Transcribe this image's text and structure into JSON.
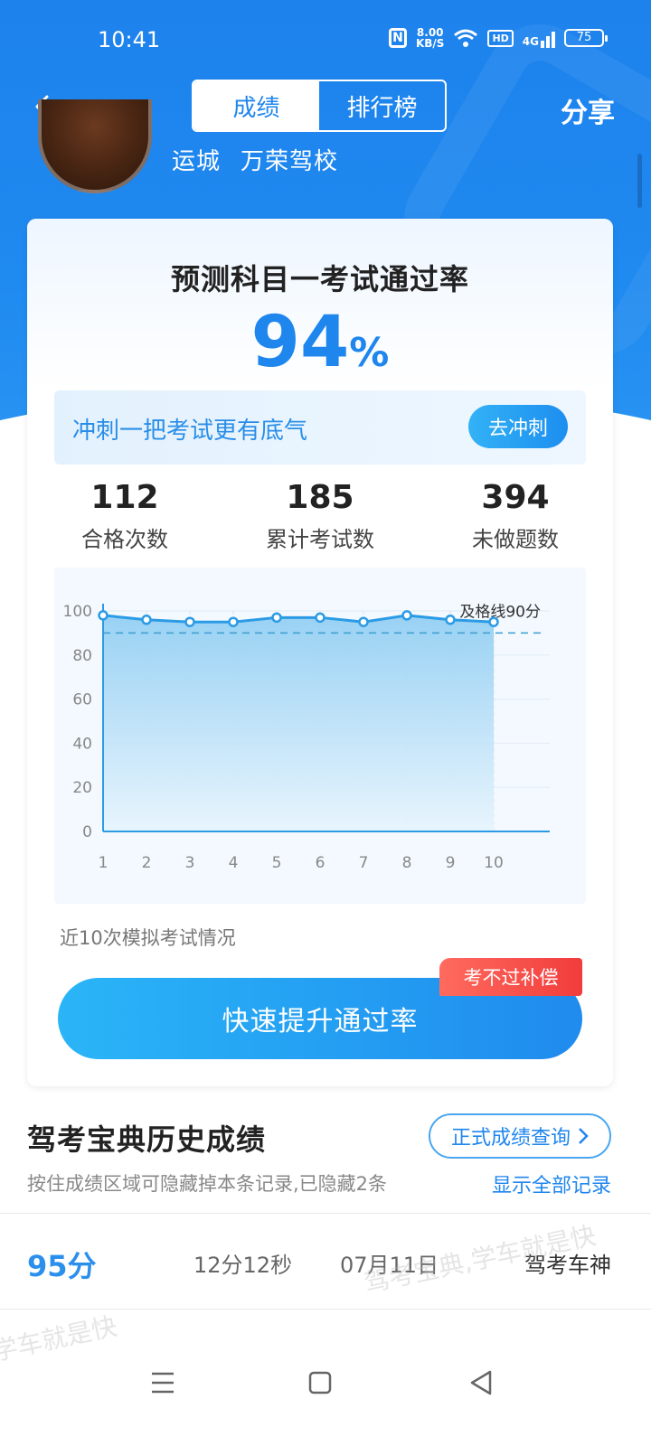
{
  "status_bar": {
    "time": "10:41",
    "net_speed_value": "8.00",
    "net_speed_unit": "KB/S",
    "hd": "HD",
    "network": "4G",
    "battery": "75"
  },
  "header": {
    "tabs": [
      {
        "label": "成绩",
        "active": true
      },
      {
        "label": "排行榜",
        "active": false
      }
    ],
    "share_label": "分享"
  },
  "profile": {
    "city": "运城",
    "school": "万荣驾校"
  },
  "prediction": {
    "title": "预测科目一考试通过率",
    "value": "94",
    "unit": "%"
  },
  "sprint": {
    "text": "冲刺一把考试更有底气",
    "button_label": "去冲刺"
  },
  "stats": [
    {
      "value": "112",
      "label": "合格次数"
    },
    {
      "value": "185",
      "label": "累计考试数"
    },
    {
      "value": "394",
      "label": "未做题数"
    }
  ],
  "chart_data": {
    "type": "area",
    "x": [
      1,
      2,
      3,
      4,
      5,
      6,
      7,
      8,
      9,
      10
    ],
    "values": [
      98,
      96,
      95,
      95,
      97,
      97,
      95,
      98,
      96,
      95
    ],
    "ylim": [
      0,
      100
    ],
    "yticks": [
      0,
      20,
      40,
      60,
      80,
      100
    ],
    "pass_line": 90,
    "pass_line_label": "及格线90分",
    "caption": "近10次模拟考试情况",
    "colors": {
      "line": "#2b9be6",
      "fill_top": "#8fcdf2",
      "fill_bottom": "#e6f4fd",
      "pass_line": "#3a9ed0"
    }
  },
  "cta": {
    "label": "快速提升通过率",
    "badge": "考不过补偿"
  },
  "history": {
    "title": "驾考宝典历史成绩",
    "official_button": "正式成绩查询",
    "subtitle": "按住成绩区域可隐藏掉本条记录,已隐藏2条",
    "show_all": "显示全部记录",
    "records": [
      {
        "score": "95分",
        "duration": "12分12秒",
        "date": "07月11日",
        "source": "驾考车神"
      }
    ]
  },
  "watermarks": [
    "驾考宝典,学车就是快",
    "学车就是快"
  ],
  "theme": {
    "primary": "#1f86ee",
    "badge_red": "#f13c3c"
  }
}
